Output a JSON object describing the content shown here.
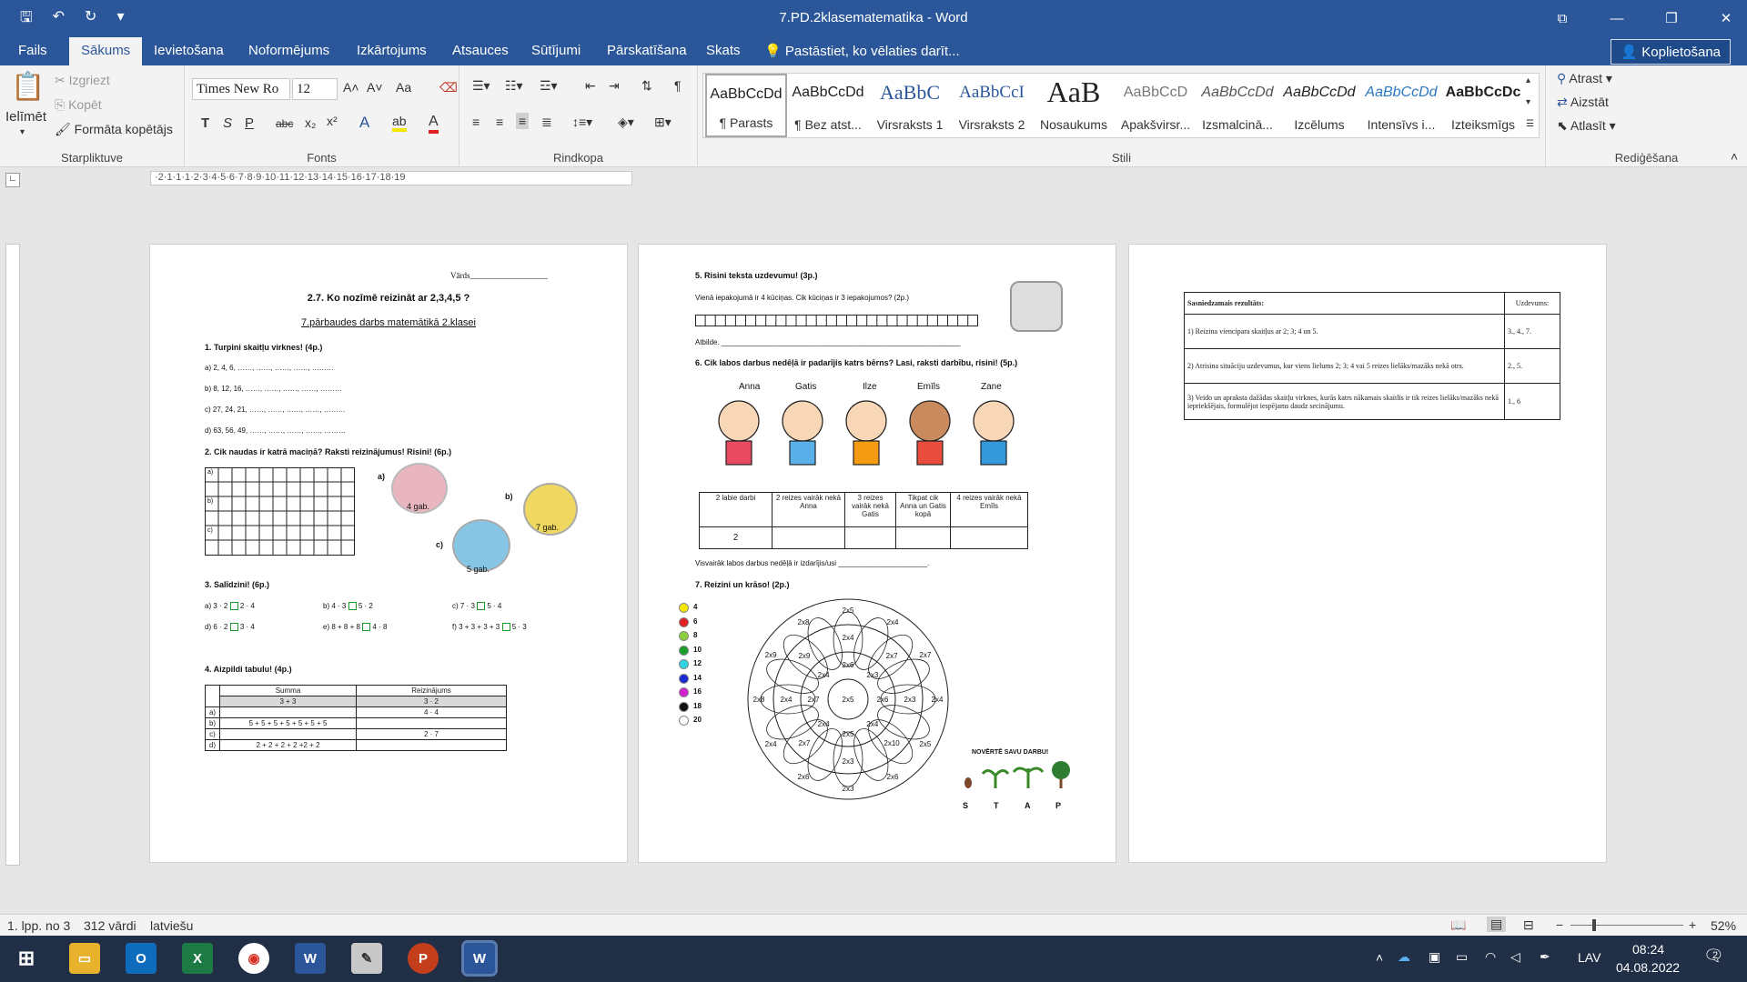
{
  "window": {
    "title": "7.PD.2klasematematika - Word"
  },
  "tabs": [
    "Fails",
    "Sākums",
    "Ievietošana",
    "Noformējums",
    "Izkārtojums",
    "Atsauces",
    "Sūtījumi",
    "Pārskatīšana",
    "Skats"
  ],
  "tellme": "Pastāstiet, ko vēlaties darīt...",
  "share": "Koplietošana",
  "clipboard": {
    "paste": "Ielīmēt",
    "cut": "Izgriezt",
    "copy": "Kopēt",
    "painter": "Formāta kopētājs",
    "label": "Starpliktuve"
  },
  "font": {
    "name": "Times New Ro",
    "size": "12",
    "label": "Fonts",
    "b": "T",
    "i": "S",
    "u": "P",
    "strike": "abc",
    "sub": "x₂",
    "sup": "x²",
    "aa": "Aa"
  },
  "paragraph": {
    "label": "Rindkopa"
  },
  "styles": {
    "label": "Stili",
    "items": [
      {
        "preview": "AaBbCcDd",
        "name": "¶ Parasts"
      },
      {
        "preview": "AaBbCcDd",
        "name": "¶ Bez atst..."
      },
      {
        "preview": "AaBbC",
        "name": "Virsraksts 1"
      },
      {
        "preview": "AaBbCcI",
        "name": "Virsraksts 2"
      },
      {
        "preview": "AaB",
        "name": "Nosaukums"
      },
      {
        "preview": "AaBbCcD",
        "name": "Apakšvirsr..."
      },
      {
        "preview": "AaBbCcDd",
        "name": "Izsmalcinā..."
      },
      {
        "preview": "AaBbCcDd",
        "name": "Izcēlums"
      },
      {
        "preview": "AaBbCcDd",
        "name": "Intensīvs i..."
      },
      {
        "preview": "AaBbCcDc",
        "name": "Izteiksmīgs"
      }
    ]
  },
  "editing": {
    "find": "Atrast",
    "replace": "Aizstāt",
    "select": "Atlasīt",
    "label": "Rediģēšana"
  },
  "ruler": "·2·1·1·1·2·3·4·5·6·7·8·9·10·11·12·13·14·15·16·17·18·19",
  "page1": {
    "name": "Vārds___________________",
    "title": "2.7. Ko nozīmē reizināt ar 2,3,4,5 ?",
    "subtitle": "7.pārbaudes darbs matemātikā 2.klasei",
    "q1": "1. Turpini skaitļu virknes! (4p.)",
    "q1a": "a) 2, 4, 6, ……, ……, ……, ……, ………",
    "q1b": "b) 8, 12, 16, ……, ……, ……, ……, ………",
    "q1c": "c) 27, 24, 21, ……, ……, ……, ……, ………",
    "q1d": "d) 63, 56, 49, ……, ……, ……, ……, ………",
    "q2": "2. Cik naudas ir katrā maciņā? Raksti reizinājumus! Risini! (6p.)",
    "gridlabels": [
      "a)",
      "b)",
      "c)"
    ],
    "purse_a": "a)",
    "purse_b": "b)",
    "purse_c": "c)",
    "gab_a": "4 gab.",
    "gab_b": "7 gab.",
    "gab_c": "5 gab.",
    "q3": "3. Salīdzini! (6p.)",
    "cmp": [
      "a) 3 · 2",
      "2 · 4",
      "b) 4 · 3",
      "5 · 2",
      "c) 7 · 3",
      "5 · 4",
      "d) 6 · 2",
      "3 · 4",
      "e) 8 + 8 + 8",
      "4 · 8",
      "f) 3 + 3 + 3 + 3",
      "5 · 3"
    ],
    "q4": "4. Aizpildi tabulu! (4p.)",
    "t4": {
      "h1": "Summa",
      "h2": "Reizinājums",
      "r0a": "3 + 3",
      "r0b": "3 · 2",
      "r1l": "a)",
      "r1b": "4 · 4",
      "r2l": "b)",
      "r2a": "5 + 5 + 5 + 5 + 5 + 5 + 5",
      "r3l": "c)",
      "r3b": "2 · 7",
      "r4l": "d)",
      "r4a": "2 + 2 + 2 + 2 +2 + 2"
    }
  },
  "page2": {
    "q5": "5. Risini teksta uzdevumu! (3p.)",
    "q5text": "Vienā iepakojumā ir 4 kūciņas. Cik kūciņas ir 3 iepakojumos? (2p.)",
    "answer": "Atbilde. ___________________________________________________________",
    "q6": "6. Cik labos darbus nedēļā ir padarījis katrs bērns? Lasi, raksti darbību, risini! (5p.)",
    "kids": [
      "Anna",
      "Gatis",
      "Ilze",
      "Emīls",
      "Zane"
    ],
    "t6": [
      "2 labie darbi",
      "2 reizes vairāk nekā Anna",
      "3 reizes vairāk nekā Gatis",
      "Tikpat cik Anna un Gatis kopā",
      "4 reizes vairāk nekā Emīls"
    ],
    "t6v": "2",
    "most": "Visvairāk labos darbus nedēļā ir izdarījis/usi ______________________.",
    "q7": "7. Reizini un krāso! (2p.)",
    "colors": [
      {
        "v": "4",
        "c": "#f5e600"
      },
      {
        "v": "6",
        "c": "#e02020"
      },
      {
        "v": "8",
        "c": "#8ccf3c"
      },
      {
        "v": "10",
        "c": "#1a9e2a"
      },
      {
        "v": "12",
        "c": "#2fd4e0"
      },
      {
        "v": "14",
        "c": "#1a2ad0"
      },
      {
        "v": "16",
        "c": "#d020d0"
      },
      {
        "v": "18",
        "c": "#111111"
      },
      {
        "v": "20",
        "c": "#ffffff"
      }
    ],
    "mandala": [
      "2x5",
      "2x4",
      "2x7",
      "2x4",
      "2x5",
      "2x6",
      "2x3",
      "2x6",
      "2x4",
      "2x8",
      "2x9",
      "2x8",
      "2x4",
      "2x7",
      "2x3",
      "2x10",
      "2x3",
      "2x7",
      "2x4",
      "2x9",
      "2x6",
      "2x3",
      "2x6",
      "2x4",
      "2x5",
      "2x4",
      "2x7",
      "2x4",
      "2x5"
    ],
    "rate": "NOVĒRTĒ SAVU DARBU!",
    "stap": [
      "S",
      "T",
      "A",
      "P"
    ]
  },
  "page3": {
    "h1": "Sasniedzamais rezultāts:",
    "h2": "Uzdevums:",
    "rows": [
      {
        "t": "1) Reizina viencipara skaitļus ar 2; 3; 4 un 5.",
        "n": "3., 4., 7."
      },
      {
        "t": "2) Atrisina situāciju uzdevumus, kur viens lielums 2; 3; 4 vai 5 reizes lielāks/mazāks nekā otrs.",
        "n": "2., 5."
      },
      {
        "t": "3) Veido un apraksta dažādas skaitļu virknes, kurās katrs nākamais skaitlis ir tik reizes lielāks/mazāks nekā iepriekšējais, formulējot iespējams daudz secinājumu.",
        "n": "1., 6"
      }
    ]
  },
  "status": {
    "page": "1. lpp. no 3",
    "words": "312 vārdi",
    "lang": "latviešu",
    "zoom": "52%"
  },
  "tray": {
    "lang": "LAV",
    "time": "08:24",
    "date": "04.08.2022",
    "notif": "2"
  }
}
